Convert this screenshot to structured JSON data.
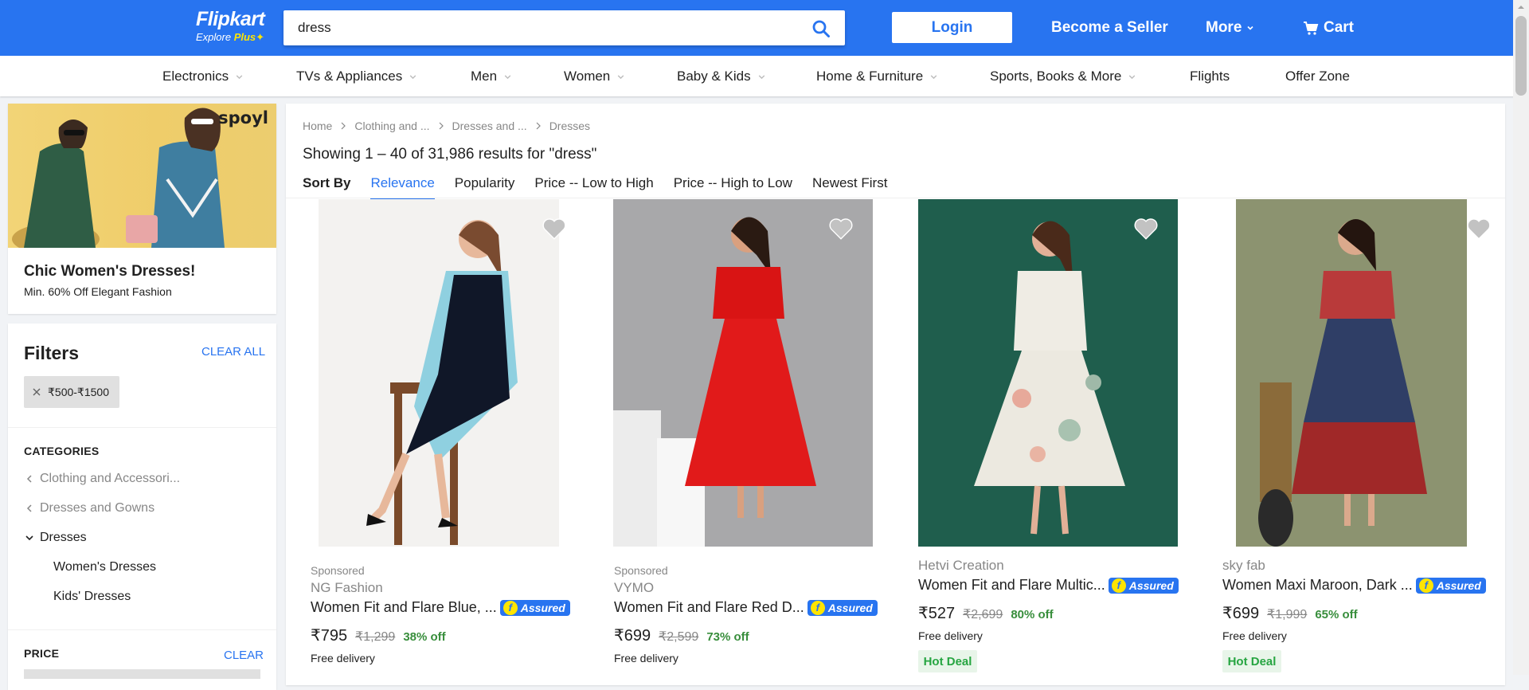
{
  "header": {
    "logo_name": "Flipkart",
    "logo_sub": "Explore",
    "logo_plus": "Plus",
    "search_value": "dress",
    "login": "Login",
    "become_seller": "Become a Seller",
    "more": "More",
    "cart": "Cart",
    "brand_color": "#2874f0"
  },
  "nav": {
    "categories": [
      "Electronics",
      "TVs & Appliances",
      "Men",
      "Women",
      "Baby & Kids",
      "Home & Furniture",
      "Sports, Books & More",
      "Flights",
      "Offer Zone"
    ]
  },
  "promo": {
    "brand": "spoyl",
    "title": "Chic Women's Dresses!",
    "subtitle": "Min. 60% Off Elegant Fashion"
  },
  "filters": {
    "title": "Filters",
    "clear_all": "CLEAR ALL",
    "chip": "₹500-₹1500",
    "categories_head": "CATEGORIES",
    "cat_items": [
      "Clothing and Accessori...",
      "Dresses and Gowns",
      "Dresses",
      "Women's Dresses",
      "Kids' Dresses"
    ],
    "price_head": "PRICE",
    "price_clear": "CLEAR"
  },
  "main": {
    "breadcrumbs": [
      "Home",
      "Clothing and ...",
      "Dresses and ...",
      "Dresses"
    ],
    "results": "Showing 1 – 40 of 31,986 results for \"dress\"",
    "sort_label": "Sort By",
    "sort_options": [
      "Relevance",
      "Popularity",
      "Price -- Low to High",
      "Price -- High to Low",
      "Newest First"
    ],
    "active_sort": "Relevance"
  },
  "products": [
    {
      "sponsored": "Sponsored",
      "brand": "NG Fashion",
      "title": "Women Fit and Flare Blue, ...",
      "assured": "Assured",
      "price": "₹795",
      "mrp": "₹1,299",
      "off": "38% off",
      "delivery": "Free delivery",
      "badge": ""
    },
    {
      "sponsored": "Sponsored",
      "brand": "VYMO",
      "title": "Women Fit and Flare Red D...",
      "assured": "Assured",
      "price": "₹699",
      "mrp": "₹2,599",
      "off": "73% off",
      "delivery": "Free delivery",
      "badge": ""
    },
    {
      "sponsored": "",
      "brand": "Hetvi Creation",
      "title": "Women Fit and Flare Multic...",
      "assured": "Assured",
      "price": "₹527",
      "mrp": "₹2,699",
      "off": "80% off",
      "delivery": "Free delivery",
      "badge": "Hot Deal"
    },
    {
      "sponsored": "",
      "brand": "sky fab",
      "title": "Women Maxi Maroon, Dark ...",
      "assured": "Assured",
      "price": "₹699",
      "mrp": "₹1,999",
      "off": "65% off",
      "delivery": "Free delivery",
      "badge": "Hot Deal"
    }
  ]
}
